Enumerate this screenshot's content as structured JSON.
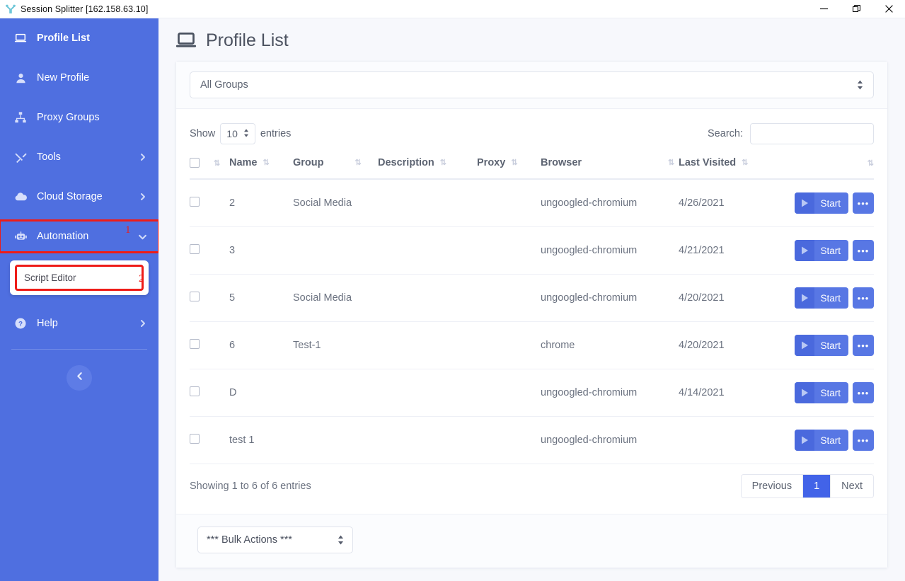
{
  "window": {
    "title": "Session Splitter [162.158.63.10]",
    "app_icon": "session-splitter-icon",
    "controls": {
      "minimize": "–",
      "restore": "❐",
      "close": "✕"
    }
  },
  "sidebar": {
    "items": [
      {
        "label": "Profile List",
        "icon": "laptop-icon",
        "active": true,
        "caret": ""
      },
      {
        "label": "New Profile",
        "icon": "user-icon",
        "active": false,
        "caret": ""
      },
      {
        "label": "Proxy Groups",
        "icon": "sitemap-icon",
        "active": false,
        "caret": ""
      },
      {
        "label": "Tools",
        "icon": "tools-icon",
        "active": false,
        "caret": "chevron-right"
      },
      {
        "label": "Cloud Storage",
        "icon": "cloud-icon",
        "active": false,
        "caret": "chevron-right"
      },
      {
        "label": "Automation",
        "icon": "robot-icon",
        "active": false,
        "caret": "chevron-down"
      },
      {
        "label": "Help",
        "icon": "question-circle-icon",
        "active": false,
        "caret": "chevron-right"
      }
    ],
    "submenu": {
      "items": [
        "Script Editor"
      ]
    },
    "collapse_button": "chevron-left-icon",
    "annotations": [
      {
        "id": "1",
        "label": "1",
        "target": "Automation"
      },
      {
        "id": "2",
        "label": "2",
        "target": "Script Editor"
      }
    ],
    "accent_color": "#4f6fe0",
    "annotation_color": "#ee1c18"
  },
  "page": {
    "icon": "laptop-icon",
    "title": "Profile List"
  },
  "filters": {
    "group_select": {
      "value": "All Groups"
    }
  },
  "table_controls": {
    "show_label": "Show",
    "length_value": "10",
    "entries_label": "entries",
    "search_label": "Search:",
    "search_value": "",
    "search_placeholder": ""
  },
  "table": {
    "columns": [
      "Name",
      "Group",
      "Description",
      "Proxy",
      "Browser",
      "Last Visited"
    ],
    "rows": [
      {
        "name": "2",
        "group": "Social Media",
        "description": "",
        "proxy": "",
        "browser": "ungoogled-chromium",
        "last_visited": "4/26/2021",
        "start_label": "Start",
        "more_label": "•••"
      },
      {
        "name": "3",
        "group": "",
        "description": "",
        "proxy": "",
        "browser": "ungoogled-chromium",
        "last_visited": "4/21/2021",
        "start_label": "Start",
        "more_label": "•••"
      },
      {
        "name": "5",
        "group": "Social Media",
        "description": "",
        "proxy": "",
        "browser": "ungoogled-chromium",
        "last_visited": "4/20/2021",
        "start_label": "Start",
        "more_label": "•••"
      },
      {
        "name": "6",
        "group": "Test-1",
        "description": "",
        "proxy": "",
        "browser": "chrome",
        "last_visited": "4/20/2021",
        "start_label": "Start",
        "more_label": "•••"
      },
      {
        "name": "D",
        "group": "",
        "description": "",
        "proxy": "",
        "browser": "ungoogled-chromium",
        "last_visited": "4/14/2021",
        "start_label": "Start",
        "more_label": "•••"
      },
      {
        "name": "test 1",
        "group": "",
        "description": "",
        "proxy": "",
        "browser": "ungoogled-chromium",
        "last_visited": "",
        "start_label": "Start",
        "more_label": "•••"
      }
    ]
  },
  "footer": {
    "entries_info": "Showing 1 to 6 of 6 entries",
    "pagination": {
      "previous": "Previous",
      "pages": [
        "1"
      ],
      "next": "Next",
      "current": "1"
    },
    "bulk_actions": {
      "value": "*** Bulk Actions ***"
    }
  }
}
